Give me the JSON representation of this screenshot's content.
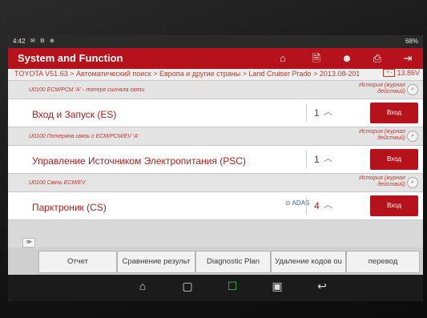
{
  "status": {
    "time": "4:42",
    "icons": "✉ ⚙ ⊕",
    "battery": "68%"
  },
  "app": {
    "title": "System and Function"
  },
  "nav": {
    "home": "⌂",
    "report": "🗎",
    "user": "☻",
    "print": "⎙",
    "exit": "⇥"
  },
  "breadcrumb": {
    "path": "TOYOTA V51.63 > Автоматический поиск > Европа и другие страны > Land Cruiser Prado > 2013.08-2015...",
    "voltage": "13.86V",
    "battery_glyph": "+ -"
  },
  "items": [
    {
      "code": "U0100 ECM/PCM 'A' - потеря сигнала связи",
      "history": "История (журнал действий)",
      "label": "Вход и Запуск (ES)",
      "count": "1",
      "enter": "Вход"
    },
    {
      "code": "U0100 Потеряна связь с ECM/PCM/EV 'A'",
      "history": "История (журнал действий)",
      "label": "Управление Источником Электропитания (PSC)",
      "count": "1",
      "enter": "Вход"
    },
    {
      "code": "U0100 Связь ECM/EV",
      "history": "История (журнал действий)",
      "label": "Парктроник (CS)",
      "count": "4",
      "enter": "Вход",
      "badge": "ADAS"
    }
  ],
  "collapse_tab": "≫",
  "bottom_buttons": [
    "Отчет",
    "Сравнение результ",
    "Diagnostic Plan",
    "Удаление кодов ou",
    "перевод"
  ],
  "sysnav": {
    "home": "⌂",
    "recent": "▢",
    "diag": "☐",
    "gallery": "▣",
    "back": "↩"
  }
}
